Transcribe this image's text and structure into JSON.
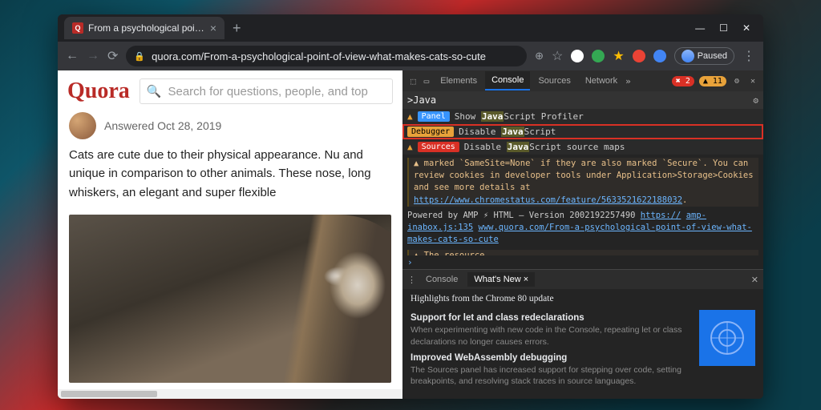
{
  "browser": {
    "tab_title": "From a psychological point of vi",
    "url": "quora.com/From-a-psychological-point-of-view-what-makes-cats-so-cute",
    "profile_status": "Paused"
  },
  "page": {
    "logo": "Quora",
    "search_placeholder": "Search for questions, people, and top",
    "answered_prefix": "Answered ",
    "answered_date": "Oct 28, 2019",
    "body": "Cats are cute due to their physical appearance. Nu and unique in comparison to other animals. These nose, long whiskers, an elegant and super flexible "
  },
  "devtools": {
    "tabs": [
      "Elements",
      "Console",
      "Sources",
      "Network"
    ],
    "active_tab": "Console",
    "error_count": 2,
    "warn_count": 11,
    "command_input": ">Java",
    "command_results": [
      {
        "category": "Panel",
        "cat_class": "cat-panel",
        "label_html": "Show <b>Java</b>Script Profiler",
        "struck": true
      },
      {
        "category": "Debugger",
        "cat_class": "cat-debug",
        "label_html": "Disable <b>Java</b>Script",
        "highlight": true
      },
      {
        "category": "Sources",
        "cat_class": "cat-src",
        "label_html": "Disable <b>Java</b>Script source maps",
        "struck": true
      }
    ],
    "messages": [
      {
        "type": "warn",
        "html": "marked `SameSite=None` if they are also marked `Secure`. You can review cookies in developer tools under Application>Storage>Cookies and see more details at <span class='link'>https://www.chromestatus.com/feature/5633521622188032</span>."
      },
      {
        "type": "plain",
        "html": "Powered by AMP ⚡ HTML – Version 2002192257490 <span class='link'>https://</span> <span class='link'>amp-inabox.js:135</span> <span class='link'>www.quora.com/From-a-psychological-point-of-view-what-makes-cats-so-cute</span>"
      },
      {
        "type": "warn",
        "html": "The resource <span class='link'>https://cdn.ampproject.org/rtv/012002192257490/amp4ads-v0.js</span> was preloaded using link preload but not used within a few seconds from the window's load event. Please make sure it has an appropriate `as` value and it is preloaded intentionally."
      }
    ]
  },
  "drawer": {
    "tabs": [
      "Console",
      "What's New"
    ],
    "active": "What's New",
    "heading": "Highlights from the Chrome 80 update",
    "items": [
      {
        "title": "Support for let and class redeclarations",
        "desc": "When experimenting with new code in the Console, repeating let or class declarations no longer causes errors."
      },
      {
        "title": "Improved WebAssembly debugging",
        "desc": "The Sources panel has increased support for stepping over code, setting breakpoints, and resolving stack traces in source languages."
      }
    ]
  }
}
